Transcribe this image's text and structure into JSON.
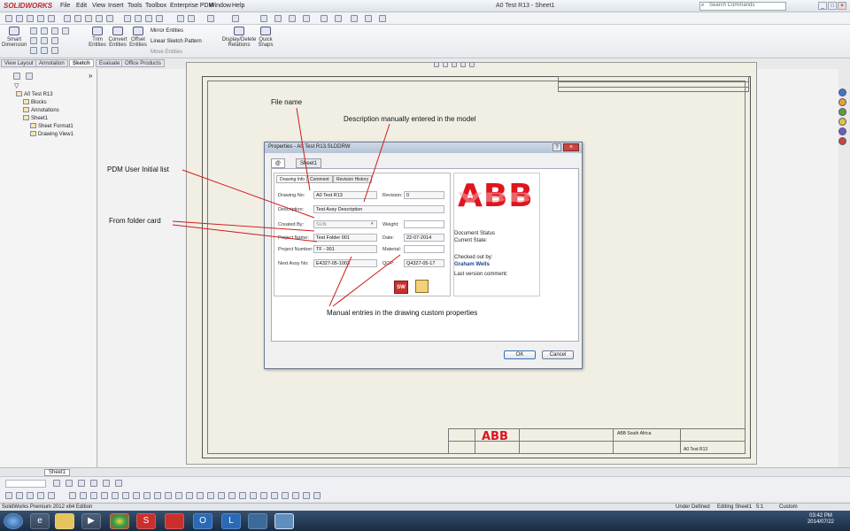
{
  "app": {
    "logo": "SOLIDWORKS",
    "menu": [
      "File",
      "Edit",
      "View",
      "Insert",
      "Tools",
      "Toolbox",
      "Enterprise PDM",
      "Window",
      "Help"
    ],
    "title": "A0 Test R13 - Sheet1",
    "search_placeholder": "Search Commands"
  },
  "command_manager": {
    "items": [
      "Smart Dimension",
      "Trim Entities",
      "Convert Entities",
      "Offset Entities",
      "Mirror Entities",
      "Linear Sketch Pattern",
      "Move Entities",
      "Display/Delete Relations",
      "Quick Snaps"
    ],
    "tabs": [
      "View Layout",
      "Annotation",
      "Sketch",
      "Evaluate",
      "Office Products"
    ],
    "active_tab": "Sketch"
  },
  "tree": {
    "root": "A0 Test R13",
    "items": [
      "Blocks",
      "Annotations",
      "Sheet1",
      "Sheet Format1",
      "Drawing View1"
    ]
  },
  "annotations": {
    "file_name": "File name",
    "description": "Description manually entered in the model",
    "pdm_user": "PDM User Initial list",
    "folder_card": "From folder card",
    "manual_entries": "Manual entries in the drawing custom properties"
  },
  "dialog": {
    "title": "Properties - A0 Test R13.SLDDRW",
    "tabs": [
      "@",
      "Sheet1"
    ],
    "form_tabs": [
      "Drawing Info",
      "Comment",
      "Revision History"
    ],
    "fields": {
      "drawing_no_label": "Drawing No:",
      "drawing_no": "A0 Test R13",
      "revision_label": "Revision:",
      "revision": "0",
      "description_label": "Description:",
      "description": "Test Assy Description",
      "created_by_label": "Created By:",
      "created_by": "SUN",
      "weight_label": "Weight:",
      "project_name_label": "Project Name:",
      "project_name": "Test Folder 001",
      "date_label": "Date:",
      "date": "22-07-2014",
      "project_number_label": "Project Number:",
      "project_number": "TF - 001",
      "material_label": "Material:",
      "next_assy_label": "Next Assy No:",
      "next_assy": "E4327-05-1003",
      "qcp_label": "QCP:",
      "qcp": "Q4327-05-17"
    },
    "logo": "ABB",
    "status": {
      "document_status": "Document Status",
      "current_state": "Current State:",
      "checked_out_by": "Checked out by:",
      "user": "Graham Wells",
      "last_comment": "Last version comment:"
    },
    "ok": "OK",
    "cancel": "Cancel"
  },
  "titleblock": {
    "company": "ABB South Africa",
    "doc": "A0 Test R13"
  },
  "bottom": {
    "sheet_tab": "Sheet1",
    "status_left": "SolidWorks Premium 2012 x64 Edition",
    "status_mid": "Under Defined",
    "editing": "Editing Sheet1",
    "scale": "5:1",
    "units": "Custom",
    "time": "03:42 PM",
    "date": "2014/07/22"
  },
  "colors": {
    "abb_red": "#e0141e",
    "leader_red": "#d11a1a"
  }
}
